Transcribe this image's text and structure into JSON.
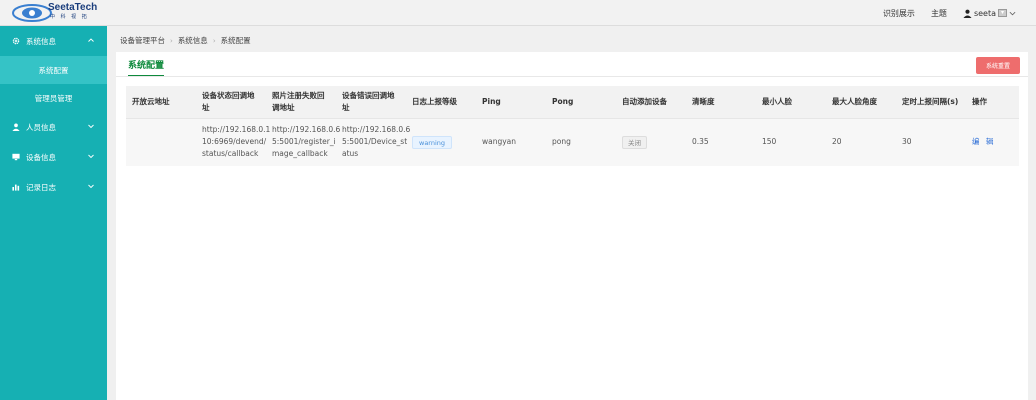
{
  "header": {
    "brand": "SeetaTech",
    "brand_sub": "中 科 视 拓",
    "nav_recognition": "识别展示",
    "nav_theme": "主题",
    "username": "seeta"
  },
  "sidebar": {
    "groups": [
      {
        "label": "系统信息",
        "expanded": true,
        "items": [
          {
            "label": "系统配置",
            "active": true
          },
          {
            "label": "管理员管理",
            "active": false
          }
        ]
      },
      {
        "label": "人员信息"
      },
      {
        "label": "设备信息"
      },
      {
        "label": "记录日志"
      }
    ]
  },
  "breadcrumb": [
    "设备管理平台",
    "系统信息",
    "系统配置"
  ],
  "panel": {
    "tab": "系统配置",
    "reset_button": "系统重置"
  },
  "table": {
    "columns": [
      [
        "开放云地址"
      ],
      [
        "设备状态回调地",
        "址"
      ],
      [
        "照片注册失败回",
        "调地址"
      ],
      [
        "设备错误回调地",
        "址"
      ],
      [
        "日志上报等级"
      ],
      [
        "Ping"
      ],
      [
        "Pong"
      ],
      [
        "自动添加设备"
      ],
      [
        "清晰度"
      ],
      [
        "最小人脸"
      ],
      [
        "最大人脸角度"
      ],
      [
        "定时上报间隔(s)"
      ],
      [
        "操作"
      ]
    ],
    "row": {
      "cloud_address": "",
      "status_callback": [
        "http://192.168.0.1",
        "10:6969/devend/",
        "status/callback"
      ],
      "register_callback": [
        "http://192.168.0.6",
        "5:5001/register_i",
        "mage_callback"
      ],
      "error_callback": [
        "http://192.168.0.6",
        "5:5001/Device_st",
        "atus"
      ],
      "log_level": "warning",
      "ping": "wangyan",
      "pong": "pong",
      "auto_add": "关闭",
      "clarity": "0.35",
      "min_face": "150",
      "max_face_angle": "20",
      "report_interval": "30",
      "action": "编 辑"
    }
  },
  "colors": {
    "sidebar": "#16b0b3",
    "sidebar_active": "#35c3c6",
    "tab_accent": "#0e8a3c",
    "reset_button": "#ee6d6d",
    "link": "#2a6cd6"
  }
}
